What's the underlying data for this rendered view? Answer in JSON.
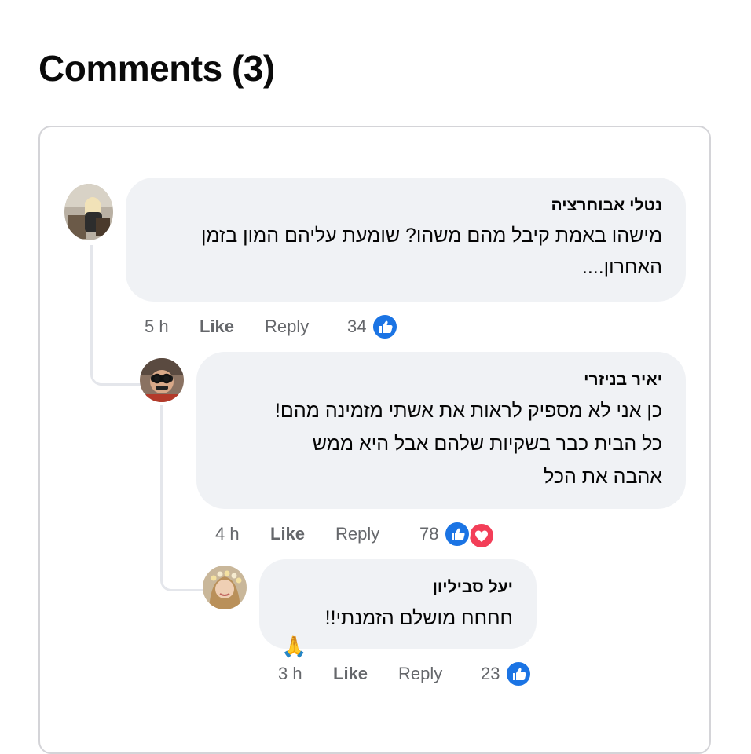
{
  "title": "Comments (3)",
  "comments": [
    {
      "author": "נטלי אבוחרציה",
      "text": "מישהו באמת קיבל מהם משהו? שומעת עליהם המון בזמן האחרון....",
      "time": "5 h",
      "like_label": "Like",
      "reply_label": "Reply",
      "reaction_count": "34",
      "reactions": [
        "like-icon"
      ]
    },
    {
      "author": "יאיר בניזרי",
      "text": "כן אני לא מספיק לראות את אשתי מזמינה מהם!\nכל הבית כבר בשקיות שלהם אבל היא ממש\nאהבה את הכל",
      "time": "4 h",
      "like_label": "Like",
      "reply_label": "Reply",
      "reaction_count": "78",
      "reactions": [
        "like-icon",
        "love-icon"
      ]
    },
    {
      "author": "יעל סביליון",
      "text": "חחחח מושלם הזמנתי!!",
      "emoji": "🙏",
      "time": "3 h",
      "like_label": "Like",
      "reply_label": "Reply",
      "reaction_count": "23",
      "reactions": [
        "like-icon"
      ]
    }
  ],
  "colors": {
    "bubble": "#f0f2f5",
    "like_blue": "#1b74e4",
    "love_red": "#f33e58",
    "meta_gray": "#65676b"
  }
}
